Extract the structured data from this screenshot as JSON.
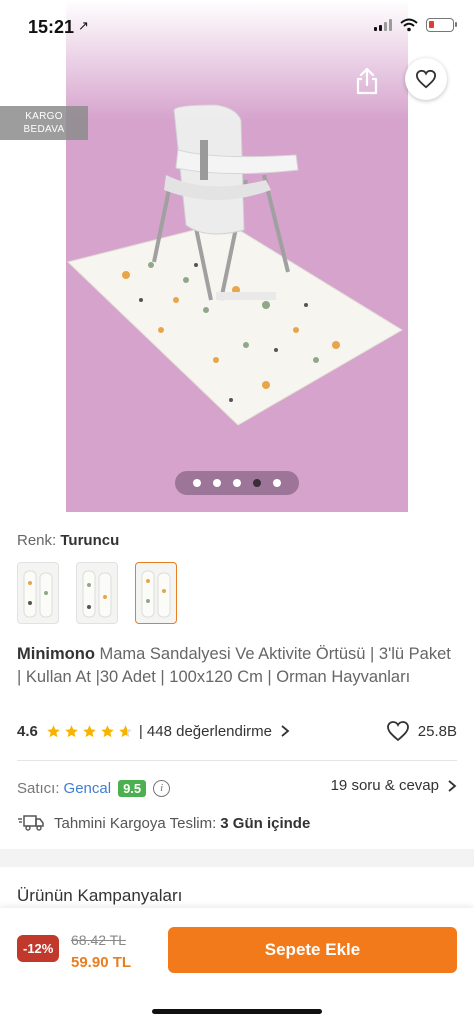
{
  "status_bar": {
    "time": "15:21"
  },
  "header": {
    "cargo_badge_line1": "KARGO",
    "cargo_badge_line2": "BEDAVA"
  },
  "gallery": {
    "dot_count": 5,
    "active_dot": 4
  },
  "color": {
    "label": "Renk:",
    "value": "Turuncu",
    "swatch_count": 3,
    "selected_index": 3
  },
  "product": {
    "brand": "Minimono",
    "name": " Mama Sandalyesi Ve Aktivite Örtüsü | 3'lü Paket | Kullan At |30 Adet | 100x120 Cm | Orman Hayvanları",
    "rating": "4.6",
    "rating_value": 4.6,
    "reviews": "| 448 değerlendirme",
    "favorites": "25.8B"
  },
  "seller": {
    "label": "Satıcı:",
    "name": "Gencal",
    "score": "9.5",
    "qa": "19 soru & cevap"
  },
  "shipping": {
    "label": "Tahmini Kargoya Teslim:",
    "value": "3 Gün içinde"
  },
  "campaigns": {
    "title": "Ürünün Kampanyaları"
  },
  "cart": {
    "discount": "-12%",
    "old_price": "68.42 TL",
    "new_price": "59.90 TL",
    "button": "Sepete Ekle"
  },
  "colors": {
    "accent": "#f27a1a",
    "seller_score": "#4caf50",
    "discount": "#c0392b",
    "photo_bg": "#d8a6cf"
  }
}
